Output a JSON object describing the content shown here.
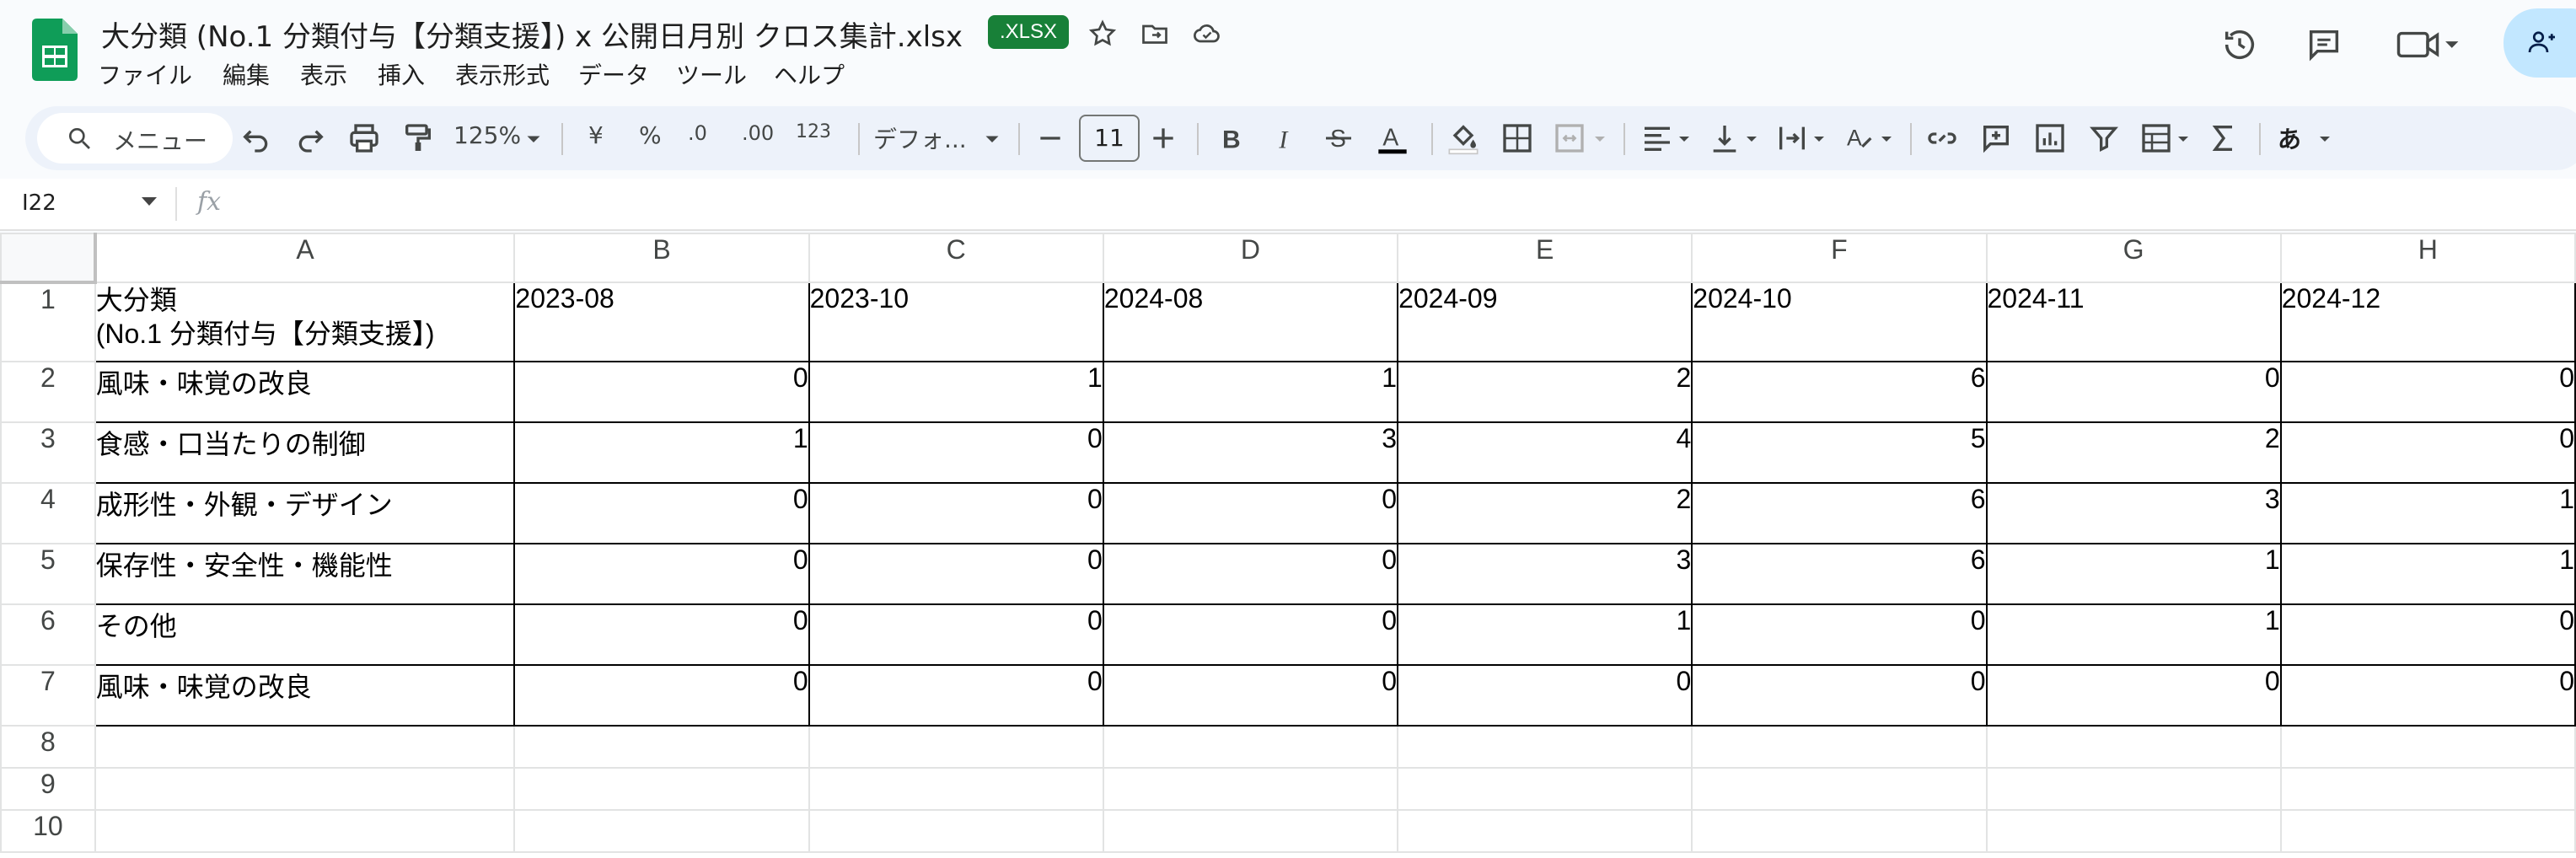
{
  "document": {
    "title": "大分類 (No.1 分類付与【分類支援】) x 公開日月別 クロス集計.xlsx",
    "badge": ".XLSX"
  },
  "menu": [
    "ファイル",
    "編集",
    "表示",
    "挿入",
    "表示形式",
    "データ",
    "ツール",
    "ヘルプ"
  ],
  "toolbar": {
    "search_label": "メニュー",
    "zoom": "125%",
    "currency": "¥",
    "percent": "%",
    "decrease_decimal": ".0",
    "increase_decimal": ".00",
    "number_format": "123",
    "font": "デフォ...",
    "font_size": "11",
    "ime": "あ"
  },
  "formula_bar": {
    "cell_ref": "I22",
    "fx": "fx"
  },
  "sheet": {
    "columns": [
      "A",
      "B",
      "C",
      "D",
      "E",
      "F",
      "G",
      "H"
    ],
    "row_numbers": [
      "1",
      "2",
      "3",
      "4",
      "5",
      "6",
      "7",
      "8",
      "9",
      "10"
    ],
    "header": [
      "大分類\n (No.1 分類付与【分類支援】)",
      "2023-08",
      "2023-10",
      "2024-08",
      "2024-09",
      "2024-10",
      "2024-11",
      "2024-12"
    ],
    "rows": [
      [
        "風味・味覚の改良",
        "0",
        "1",
        "1",
        "2",
        "6",
        "0",
        "0"
      ],
      [
        "食感・口当たりの制御",
        "1",
        "0",
        "3",
        "4",
        "5",
        "2",
        "0"
      ],
      [
        "成形性・外観・デザイン",
        "0",
        "0",
        "0",
        "2",
        "6",
        "3",
        "1"
      ],
      [
        "保存性・安全性・機能性",
        "0",
        "0",
        "0",
        "3",
        "6",
        "1",
        "1"
      ],
      [
        "その他",
        "0",
        "0",
        "0",
        "1",
        "0",
        "1",
        "0"
      ],
      [
        "風味・味覚の改良",
        "0",
        "0",
        "0",
        "0",
        "0",
        "0",
        "0"
      ]
    ]
  },
  "icons": {
    "app": "google-sheets-icon",
    "star": "star-icon",
    "move": "move-to-folder-icon",
    "cloud": "cloud-saved-icon",
    "history": "history-icon",
    "comments": "comments-icon",
    "meet": "video-call-icon",
    "share": "share-icon"
  },
  "colors": {
    "brand_green": "#188038",
    "toolbar_bg": "#edf2fa",
    "share_bg": "#c2e7ff"
  }
}
